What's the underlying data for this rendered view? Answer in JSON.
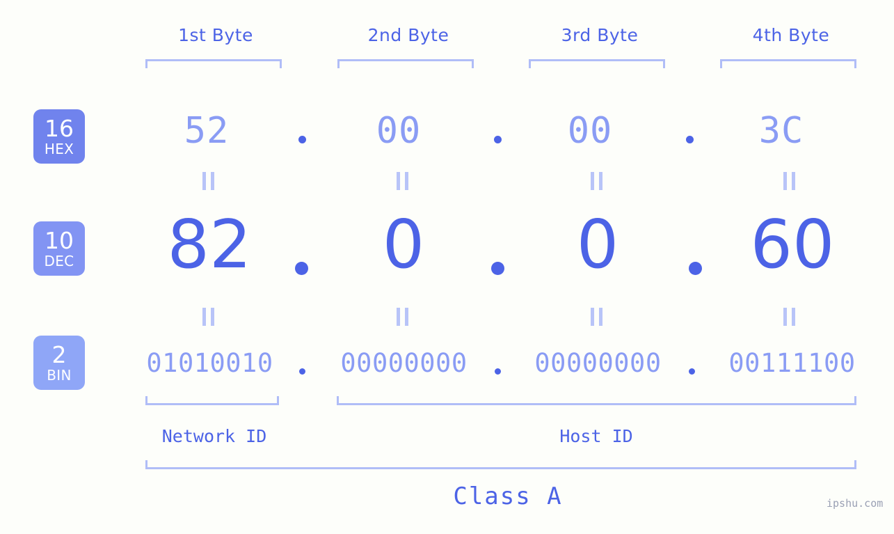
{
  "background_color": "#fdfefa",
  "accent_color": "#4c63e6",
  "secondary_color": "#8a9cf4",
  "bracket_color": "#b0bdf7",
  "byte_headers": [
    {
      "label": "1st Byte"
    },
    {
      "label": "2nd Byte"
    },
    {
      "label": "3rd Byte"
    },
    {
      "label": "4th Byte"
    }
  ],
  "rows": {
    "hex": {
      "badge_number": "16",
      "badge_abbr": "HEX",
      "badge_color": "#7083ed",
      "values": [
        "52",
        "00",
        "00",
        "3C"
      ],
      "separator": "."
    },
    "dec": {
      "badge_number": "10",
      "badge_abbr": "DEC",
      "badge_color": "#8294f3",
      "values": [
        "82",
        "0",
        "0",
        "60"
      ],
      "separator": "."
    },
    "bin": {
      "badge_number": "2",
      "badge_abbr": "BIN",
      "badge_color": "#8fa6f7",
      "values": [
        "01010010",
        "00000000",
        "00000000",
        "00111100"
      ],
      "separator": "."
    }
  },
  "equals_marks": {
    "glyph": "||",
    "count_per_row": 4
  },
  "sections": {
    "network_id": {
      "label": "Network ID"
    },
    "host_id": {
      "label": "Host ID"
    },
    "class": {
      "label": "Class A"
    }
  },
  "watermark": {
    "text": "ipshu.com"
  },
  "address": {
    "hex": "52.00.00.3C",
    "dec": "82.0.0.60",
    "bin": "01010010.00000000.00000000.00111100"
  }
}
